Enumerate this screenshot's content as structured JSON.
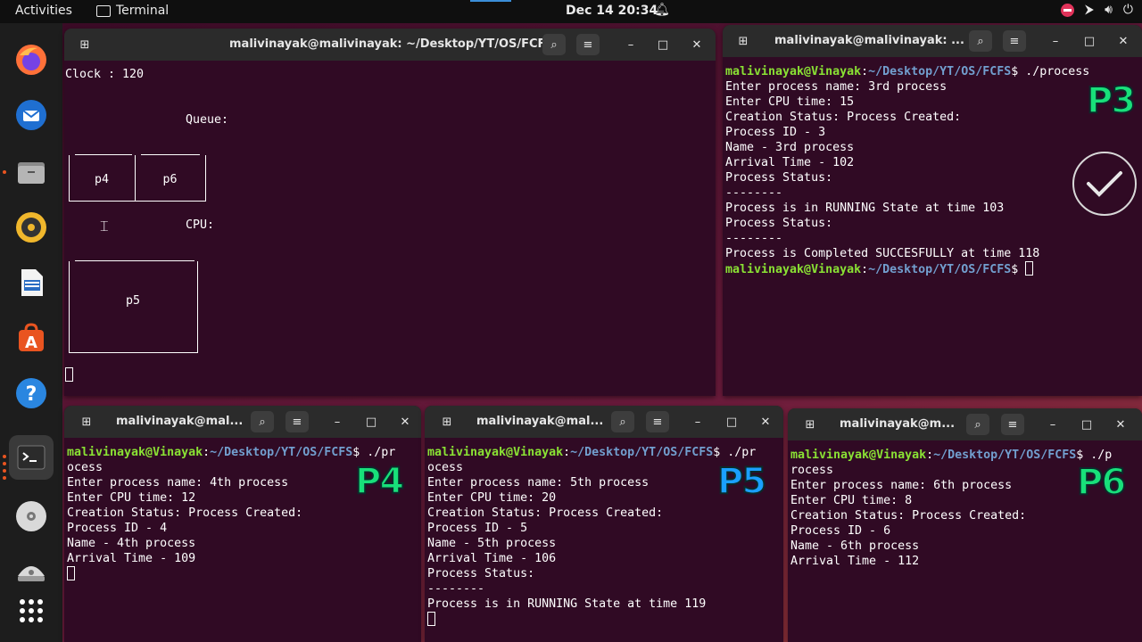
{
  "topbar": {
    "activities": "Activities",
    "app_name": "Terminal",
    "datetime": "Dec 14  20:34"
  },
  "dock": {
    "items": [
      "firefox-icon",
      "thunderbird-icon",
      "files-icon",
      "rhythmbox-icon",
      "writer-icon",
      "app-center-icon",
      "help-icon",
      "terminal-icon",
      "disc-icon",
      "disc-icon-2",
      "show-apps-icon"
    ]
  },
  "main_window": {
    "title": "malivinayak@malivinayak: ~/Desktop/YT/OS/FCFS",
    "clock_label": "Clock : 120",
    "queue_label": "Queue:",
    "queue_items": [
      "p4",
      "p6"
    ],
    "cpu_label": "CPU:",
    "cpu_process": "p5"
  },
  "p3_window": {
    "title": "malivinayak@malivinayak: ...",
    "badge": "P3",
    "prompt_user": "malivinayak@Vinayak",
    "prompt_path": "~/Desktop/YT/OS/FCFS",
    "command": "$ ./process",
    "lines": [
      "Enter process name: 3rd process",
      "Enter CPU time: 15",
      "Creation Status: Process Created:",
      "Process ID - 3",
      "Name - 3rd process",
      "Arrival Time - 102",
      "Process Status:",
      "--------",
      "Process is in RUNNING State at time 103",
      "Process Status:",
      "--------",
      "Process is Completed SUCCESFULLY at time 118"
    ],
    "final_prompt_suffix": "$ "
  },
  "p4_window": {
    "title": "malivinayak@mal...",
    "badge": "P4",
    "prompt_user": "malivinayak@Vinayak",
    "prompt_path": "~/Desktop/YT/OS/FCFS",
    "command": "$ ./pr",
    "command_wrap": "ocess",
    "lines": [
      "Enter process name: 4th process",
      "Enter CPU time: 12",
      "Creation Status: Process Created:",
      "Process ID - 4",
      "Name - 4th process",
      "Arrival Time - 109"
    ]
  },
  "p5_window": {
    "title": "malivinayak@mal...",
    "badge": "P5",
    "prompt_user": "malivinayak@Vinayak",
    "prompt_path": "~/Desktop/YT/OS/FCFS",
    "command": "$ ./pr",
    "command_wrap": "ocess",
    "lines": [
      "Enter process name: 5th process",
      "Enter CPU time: 20",
      "Creation Status: Process Created:",
      "Process ID - 5",
      "Name - 5th process",
      "Arrival Time - 106",
      "Process Status:",
      "--------",
      "Process is in RUNNING State at time 119"
    ]
  },
  "p6_window": {
    "title": "malivinayak@m...",
    "badge": "P6",
    "prompt_user": "malivinayak@Vinayak",
    "prompt_path": "~/Desktop/YT/OS/FCFS",
    "command": "$ ./p",
    "command_wrap": "rocess",
    "lines": [
      "Enter process name: 6th process",
      "Enter CPU time: 8",
      "Creation Status: Process Created:",
      "Process ID - 6",
      "Name - 6th process",
      "Arrival Time - 112"
    ]
  },
  "colors": {
    "terminal_bg": "#300a24",
    "prompt_user": "#8ae234",
    "prompt_path": "#729fcf",
    "badge_green": "#18e07a",
    "badge_blue": "#1aa0ff"
  }
}
